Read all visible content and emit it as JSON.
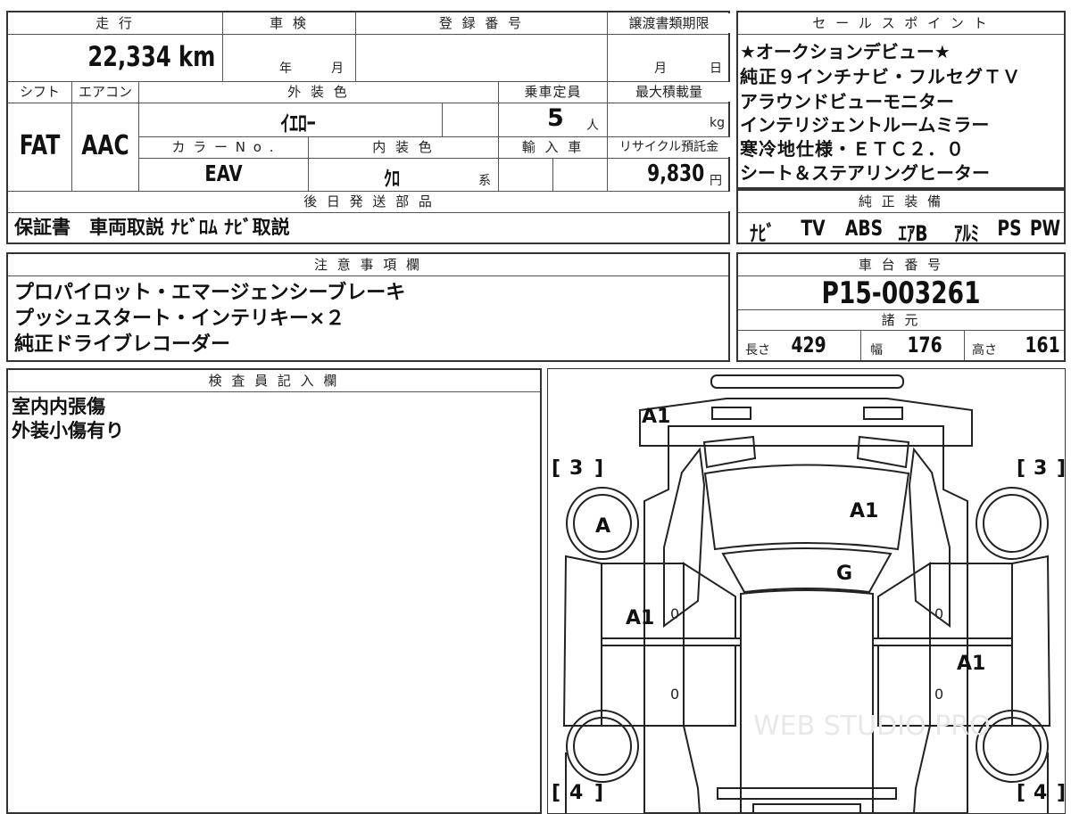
{
  "headers": {
    "mileage": "走 行",
    "inspection": "車 検",
    "registration": "登 録 番 号",
    "transfer_deadline": "譲渡書類期限",
    "shift": "シフト",
    "aircon": "エアコン",
    "exterior_color": "外 装 色",
    "capacity": "乗車定員",
    "max_load": "最大積載量",
    "color_no": "カ ラ ー N o .",
    "interior_color": "内 装 色",
    "import": "輸 入 車",
    "recycle_fee": "リサイクル預託金",
    "later_parts": "後 日 発 送 部 品",
    "notes": "注 意 事 項 欄",
    "inspector": "検 査 員 記 入 欄",
    "sales_points": "セ ー ル ス ポ イ ン ト",
    "equipment": "純 正 装 備",
    "chassis": "車 台 番 号",
    "specs": "諸 元"
  },
  "vehicle": {
    "mileage": "22,334 km",
    "inspection_year_unit": "年",
    "inspection_month_unit": "月",
    "transfer_month_unit": "月",
    "transfer_day_unit": "日",
    "shift": "FAT",
    "aircon": "AAC",
    "exterior_color": "ｲｴﾛｰ",
    "capacity": "5",
    "capacity_unit": "人",
    "max_load_unit": "kg",
    "color_no": "EAV",
    "interior_color": "ｸﾛ",
    "interior_suffix": "系",
    "recycle_fee": "9,830",
    "recycle_unit": "円",
    "later_parts": "保証書　車両取説 ﾅﾋﾞﾛﾑ ﾅﾋﾞ取説",
    "chassis": "P15-003261",
    "length_label": "長さ",
    "length": "429",
    "width_label": "幅",
    "width": "176",
    "height_label": "高さ",
    "height": "161"
  },
  "sales_points": [
    "★オークションデビュー★",
    "純正９インチナビ・フルセグＴＶ",
    "アラウンドビューモニター",
    "インテリジェントルームミラー",
    "寒冷地仕様・ＥＴＣ２．０",
    "シート＆ステアリングヒーター"
  ],
  "equipment": [
    "ﾅﾋﾞ",
    "TV",
    "ABS",
    "ｴｱB",
    "ｱﾙﾐ",
    "PS",
    "PW"
  ],
  "notes": [
    "プロパイロット・エマージェンシーブレーキ",
    "プッシュスタート・インテリキー×２",
    "純正ドライブレコーダー"
  ],
  "inspector_notes": [
    "室内内張傷",
    "外装小傷有り"
  ],
  "diagram": {
    "front_marks": [
      "[",
      "3",
      "]"
    ],
    "rear_marks": [
      "[",
      "4",
      "]"
    ],
    "labels": {
      "rear_bumper": "A1",
      "left_front_wheel": "A",
      "hood": "A1",
      "windshield": "G",
      "left_front_door": "A1",
      "right_rear_door": "A1",
      "zero": "0"
    },
    "watermark": "WEB STUDIO PRO"
  }
}
